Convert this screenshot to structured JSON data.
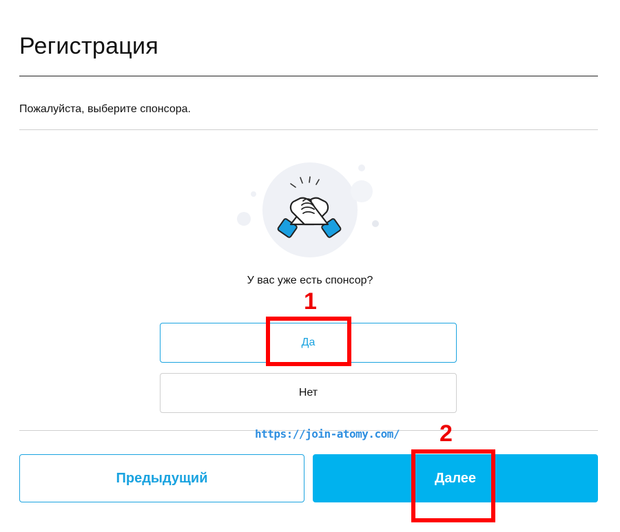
{
  "page": {
    "title": "Регистрация",
    "subtitle": "Пожалуйста, выберите спонсора."
  },
  "sponsor_question": {
    "text": "У вас уже есть спонсор?",
    "options": [
      {
        "label": "Да",
        "selected": true
      },
      {
        "label": "Нет",
        "selected": false
      }
    ],
    "illustration_icon": "handshake-icon"
  },
  "footer": {
    "watermark": "https://join-atomy.com/",
    "prev_label": "Предыдущий",
    "next_label": "Далее"
  },
  "annotations": {
    "marker_1": "1",
    "marker_2": "2",
    "marker_color": "#ff0000"
  },
  "colors": {
    "accent": "#1aa3e0",
    "primary_button": "#00b2ee",
    "icon_blue": "#1a9fe0",
    "illustration_bg": "#eff1f6"
  }
}
